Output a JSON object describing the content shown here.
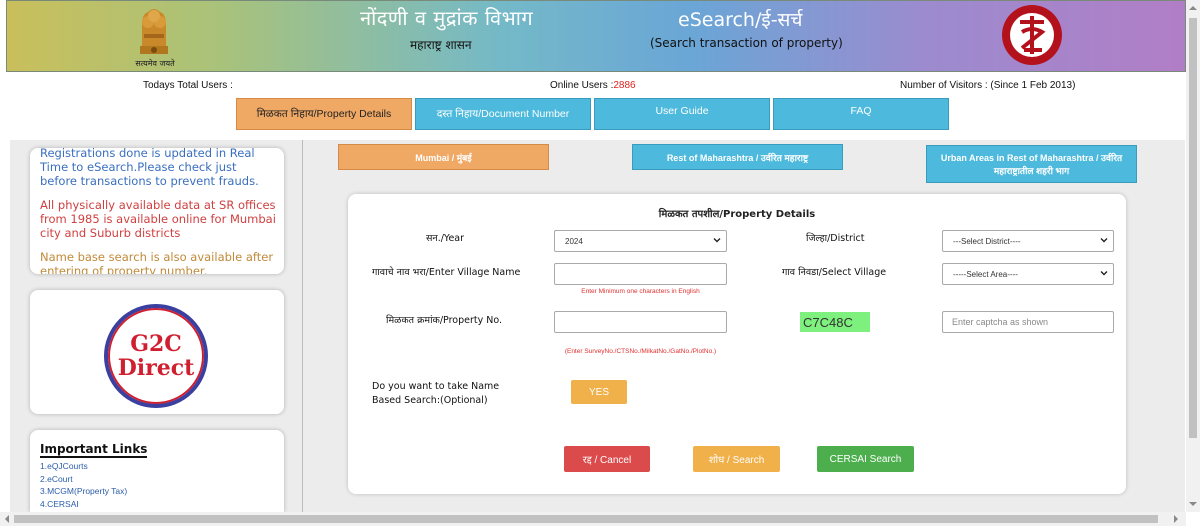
{
  "header": {
    "title_mr": "नोंदणी व मुद्रांक विभाग",
    "subtitle_mr": "महाराष्ट्र शासन",
    "title_en": "eSearch/ई-सर्च",
    "subtitle_en": "(Search transaction of property)",
    "emblem_caption": "सत्यमेव जयते",
    "accent": "#4db9dc",
    "active_color": "#f0a865"
  },
  "stats": {
    "total_users_label": "Todays Total Users :",
    "online_users_label": "Online Users :",
    "online_users_value": "2886",
    "visitors_label": "Number of Visitors : (Since 1 Feb 2013)"
  },
  "nav": [
    {
      "label": "मिळकत निहाय/Property Details"
    },
    {
      "label": "दस्त निहाय/Document Number"
    },
    {
      "label": "User Guide"
    },
    {
      "label": "FAQ"
    }
  ],
  "sidebar": {
    "news": [
      "Registrations done is updated in Real Time to eSearch.Please check just before transactions to prevent frauds.",
      "All physically available data at SR offices from 1985 is available online for Mumbai city and Suburb districts",
      "Name base search is also available after entering of property number."
    ],
    "g2c_line1": "G2C",
    "g2c_line2": "Direct",
    "links_title": "Important Links",
    "links": [
      "1.eQJCourts",
      "2.eCourt",
      "3.MCGM(Property Tax)",
      "4.CERSAI"
    ]
  },
  "areas": [
    {
      "label": "Mumbai / मुंबई"
    },
    {
      "label": "Rest of Maharashtra / उर्वरित महाराष्ट्र"
    },
    {
      "label": "Urban Areas in Rest of Maharashtra / उर्वरित महाराष्ट्रातील शहरी भाग"
    }
  ],
  "form": {
    "title": "मिळकत तपशील/Property Details",
    "year_label": "सन./Year",
    "year_value": "2024",
    "district_label": "जिल्हा/District",
    "district_value": "---Select District----",
    "village_name_label": "गावाचे नाव भरा/Enter Village Name",
    "village_hint": "Enter Minimum one characters in English",
    "select_village_label": "गाव निवडा/Select Village",
    "select_village_value": "-----Select Area----",
    "property_no_label": "मिळकत क्रमांक/Property No.",
    "property_hint": "(Enter SurveyNo./CTSNo./MilkatNo./GatNo./PlotNo.)",
    "captcha_code": "C7C48C",
    "captcha_placeholder": "Enter captcha as shown",
    "name_search_label": "Do you want to take Name Based Search:(Optional)",
    "yes_label": "YES",
    "cancel_label": "रद्द / Cancel",
    "search_label": "शोध / Search",
    "cersai_label": "CERSAI Search"
  }
}
